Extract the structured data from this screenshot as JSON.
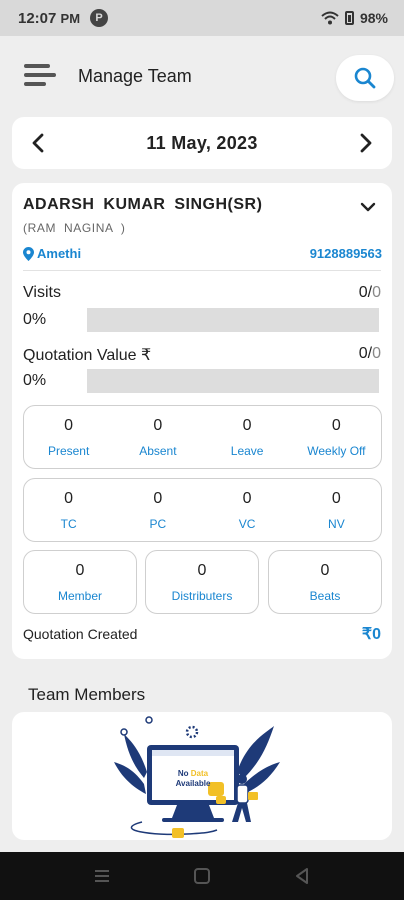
{
  "status_bar": {
    "time": "12:07",
    "period": "PM",
    "app_icon": "P",
    "battery": "98%"
  },
  "header": {
    "title": "Manage Team",
    "icons": [
      "menu-icon",
      "search-icon"
    ]
  },
  "date_nav": {
    "date": "11 May, 2023",
    "icons": [
      "chevron-left-icon",
      "chevron-right-icon"
    ]
  },
  "employee": {
    "name": "ADARSH KUMAR SINGH(SR)",
    "sub": "(RAM NAGINA )",
    "location": "Amethi",
    "phone": "9128889563"
  },
  "metrics": {
    "visits": {
      "label": "Visits",
      "done": "0",
      "total": "0",
      "percent": "0%",
      "progress": 0
    },
    "quotation": {
      "label": "Quotation Value ₹",
      "done": "0",
      "total": "0",
      "percent": "0%",
      "progress": 0
    }
  },
  "attendance": [
    {
      "value": "0",
      "label": "Present"
    },
    {
      "value": "0",
      "label": "Absent"
    },
    {
      "value": "0",
      "label": "Leave"
    },
    {
      "value": "0",
      "label": "Weekly Off"
    }
  ],
  "calls": [
    {
      "value": "0",
      "label": "TC"
    },
    {
      "value": "0",
      "label": "PC"
    },
    {
      "value": "0",
      "label": "VC"
    },
    {
      "value": "0",
      "label": "NV"
    }
  ],
  "counts": [
    {
      "value": "0",
      "label": "Member"
    },
    {
      "value": "0",
      "label": "Distributers"
    },
    {
      "value": "0",
      "label": "Beats"
    }
  ],
  "quotation_created": {
    "label": "Quotation Created",
    "value": "₹0"
  },
  "team": {
    "title": "Team Members",
    "empty_line1": "No",
    "empty_highlight": "Data",
    "empty_line2": "Available"
  },
  "colors": {
    "accent": "#1a86d0",
    "background": "#eeeeee",
    "card": "#ffffff",
    "track": "#dddddd",
    "illustration": "#1e3a78",
    "plug": "#f2c027"
  }
}
